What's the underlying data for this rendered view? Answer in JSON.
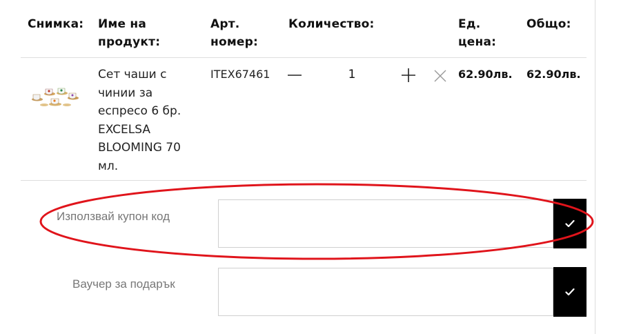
{
  "table": {
    "headers": {
      "image": "Снимка:",
      "name_line1": "Име на",
      "name_line2": "продукт:",
      "sku_line1": "Арт.",
      "sku_line2": "номер:",
      "quantity": "Количество:",
      "unit_price_line1": "Ед.",
      "unit_price_line2": "цена:",
      "total": "Общо:"
    },
    "rows": [
      {
        "name_lines": [
          "Сет чаши с",
          "чинии за",
          "еспресо 6 бр.",
          "EXCELSA",
          "BLOOMING 70",
          "мл."
        ],
        "sku": "ITEX67461",
        "quantity": "1",
        "unit_price": "62.90лв.",
        "total": "62.90лв."
      }
    ]
  },
  "coupon": {
    "label": "Използвай купон код",
    "value": "",
    "placeholder": ""
  },
  "voucher": {
    "label": "Ваучер за подарък",
    "value": "",
    "placeholder": ""
  },
  "colors": {
    "highlight": "#e0141b",
    "apply_button": "#000000"
  },
  "icons": {
    "decrease": "minus-icon",
    "increase": "plus-icon",
    "remove": "close-icon",
    "apply": "check-icon"
  }
}
